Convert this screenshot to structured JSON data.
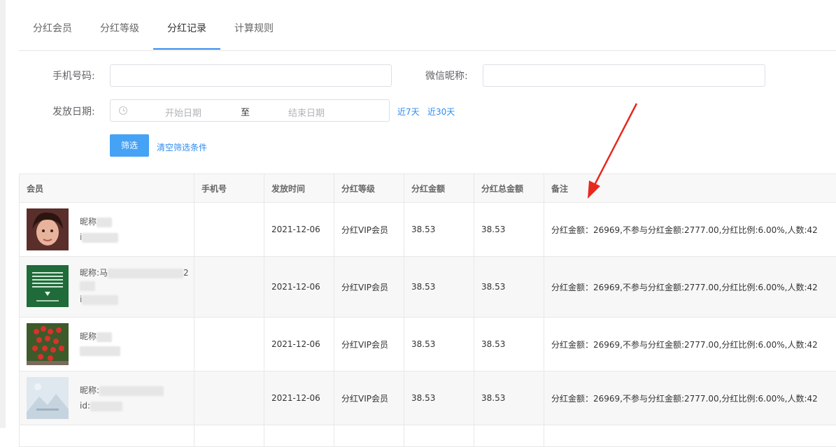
{
  "tabs": [
    {
      "label": "分红会员"
    },
    {
      "label": "分红等级"
    },
    {
      "label": "分红记录"
    },
    {
      "label": "计算规则"
    }
  ],
  "filters": {
    "phone_label": "手机号码:",
    "wechat_label": "微信昵称:",
    "date_label": "发放日期:",
    "start_placeholder": "开始日期",
    "range_sep": "至",
    "end_placeholder": "结束日期",
    "quick_7": "近7天",
    "quick_30": "近30天",
    "filter_button": "筛选",
    "clear_link": "清空筛选条件"
  },
  "table": {
    "headers": [
      "会员",
      "手机号",
      "发放时间",
      "分红等级",
      "分红金额",
      "分红总金额",
      "备注"
    ],
    "rows": [
      {
        "nick": "昵称",
        "id_prefix": "i",
        "phone": "",
        "time": "2021-12-06",
        "level": "分红VIP会员",
        "amount": "38.53",
        "total": "38.53",
        "remark": "分红金额：26969,不参与分红金额:2777.00,分红比例:6.00%,人数:42"
      },
      {
        "nick": "昵称:马",
        "nick_tail": "2",
        "id_prefix": "i",
        "phone": "",
        "time": "2021-12-06",
        "level": "分红VIP会员",
        "amount": "38.53",
        "total": "38.53",
        "remark": "分红金额：26969,不参与分红金额:2777.00,分红比例:6.00%,人数:42"
      },
      {
        "nick": "昵称",
        "id_prefix": "",
        "phone": "",
        "time": "2021-12-06",
        "level": "分红VIP会员",
        "amount": "38.53",
        "total": "38.53",
        "remark": "分红金额：26969,不参与分红金额:2777.00,分红比例:6.00%,人数:42"
      },
      {
        "nick": "昵称:",
        "id_prefix": "id:",
        "phone": "",
        "time": "2021-12-06",
        "level": "分红VIP会员",
        "amount": "38.53",
        "total": "38.53",
        "remark": "分红金额：26969,不参与分红金额:2777.00,分红比例:6.00%,人数:42"
      }
    ]
  },
  "colors": {
    "accent": "#2d8cf0",
    "button": "#46a2f5",
    "annotation_arrow": "#e8281c"
  }
}
